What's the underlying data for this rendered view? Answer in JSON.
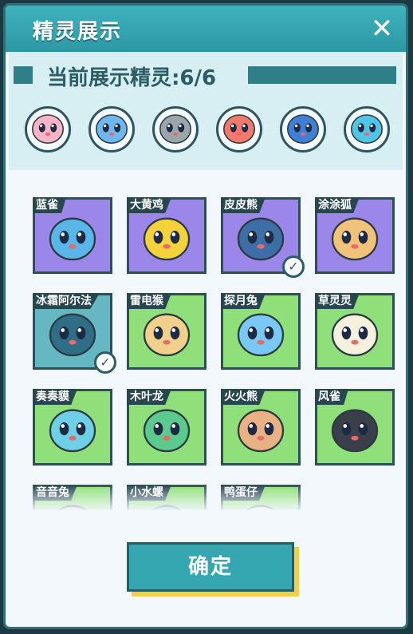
{
  "window": {
    "title": "精灵展示",
    "close_icon": "close-icon"
  },
  "showcase": {
    "label": "当前展示精灵:6/6",
    "slots": [
      {
        "icon": "pink-sprite-avatar",
        "color": "#f7b4c8"
      },
      {
        "icon": "blue-water-sprite-avatar",
        "color": "#6fb7ef"
      },
      {
        "icon": "penguin-sprite-avatar",
        "color": "#9aa6ab"
      },
      {
        "icon": "red-fire-sprite-avatar",
        "color": "#f2796b"
      },
      {
        "icon": "blue-sprite-avatar",
        "color": "#3f7fd6"
      },
      {
        "icon": "dark-blue-sprite-avatar",
        "color": "#4fc6e5"
      }
    ]
  },
  "sprites": [
    {
      "name": "蓝雀",
      "bg": "#9b86ea",
      "body": "#59b6e8",
      "selected": false
    },
    {
      "name": "大黄鸡",
      "bg": "#9b86ea",
      "body": "#f4d23c",
      "selected": false
    },
    {
      "name": "皮皮熊",
      "bg": "#9b86ea",
      "body": "#3d6fa6",
      "selected": true
    },
    {
      "name": "涂涂狐",
      "bg": "#9b86ea",
      "body": "#f1c27a",
      "selected": false
    },
    {
      "name": "冰霜阿尔法",
      "bg": "#65b7c2",
      "body": "#2f6e86",
      "selected": true
    },
    {
      "name": "雷电猴",
      "bg": "#8fe07a",
      "body": "#f0d08a",
      "selected": false
    },
    {
      "name": "探月兔",
      "bg": "#8fe07a",
      "body": "#7ac8f4",
      "selected": false
    },
    {
      "name": "草灵灵",
      "bg": "#8fe07a",
      "body": "#f5f1de",
      "selected": false
    },
    {
      "name": "奏奏貘",
      "bg": "#8fe07a",
      "body": "#6fcfe6",
      "selected": false
    },
    {
      "name": "木叶龙",
      "bg": "#8fe07a",
      "body": "#5cc98d",
      "selected": false
    },
    {
      "name": "火火熊",
      "bg": "#8fe07a",
      "body": "#e8b284",
      "selected": false
    },
    {
      "name": "风雀",
      "bg": "#8fe07a",
      "body": "#3a3f4b",
      "selected": false
    },
    {
      "name": "音音兔",
      "bg": "#8fe07a",
      "body": "#f3a1c9",
      "selected": false
    },
    {
      "name": "小水螺",
      "bg": "#8fe07a",
      "body": "#6cb3ea",
      "selected": false
    },
    {
      "name": "鸭蛋仔",
      "bg": "#8fe07a",
      "body": "#f4f0e0",
      "selected": false
    }
  ],
  "confirm_label": "确定",
  "colors": {
    "accent": "#34a7b0",
    "title_bar": "#3fb3bd",
    "highlight": "#f2cf47"
  }
}
